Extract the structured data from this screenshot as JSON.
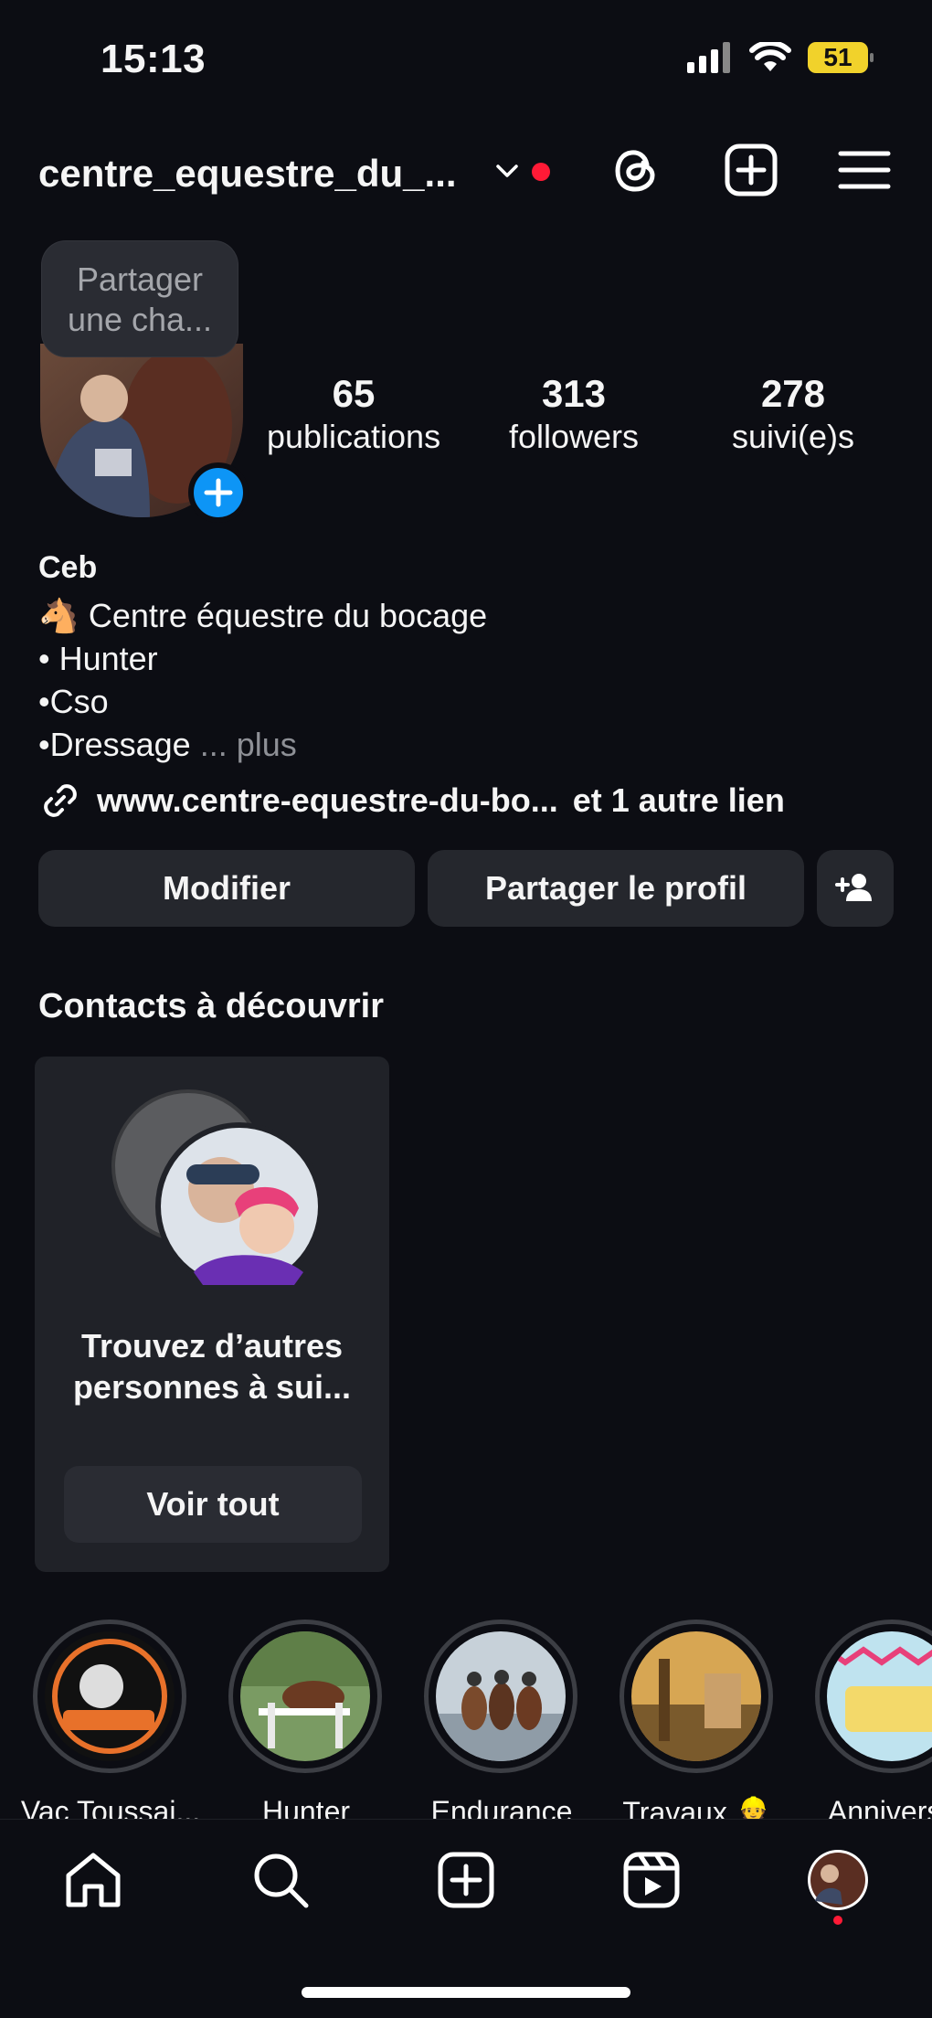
{
  "status": {
    "time": "15:13",
    "battery": "51"
  },
  "header": {
    "username": "centre_equestre_du_..."
  },
  "tooltip": {
    "line1": "Partager",
    "line2": "une cha..."
  },
  "stats": [
    {
      "value": "65",
      "label": "publications"
    },
    {
      "value": "313",
      "label": "followers"
    },
    {
      "value": "278",
      "label": "suivi(e)s"
    }
  ],
  "profile": {
    "name": "Ceb",
    "bio_line1_emoji": "🐴",
    "bio_line1": "Centre équestre du bocage",
    "bio_line2": "• Hunter",
    "bio_line3": "•Cso",
    "bio_line4": "•Dressage",
    "bio_more": "... plus",
    "link": "www.centre-equestre-du-bo...",
    "link_extra": "et 1 autre lien"
  },
  "buttons": {
    "edit": "Modifier",
    "share": "Partager le profil"
  },
  "discover": {
    "title": "Contacts à découvrir",
    "card_text": "Trouvez d’autres personnes à sui...",
    "card_button": "Voir tout"
  },
  "highlights": [
    {
      "label": "Vac Toussai..."
    },
    {
      "label": "Hunter"
    },
    {
      "label": "Endurance"
    },
    {
      "label": "Travaux 👷"
    },
    {
      "label": "Anniversa"
    }
  ],
  "colors": {
    "accent_blue": "#0d95f6",
    "notification_red": "#ff1a36",
    "background": "#0c0d13",
    "button_bg": "#25272d"
  }
}
